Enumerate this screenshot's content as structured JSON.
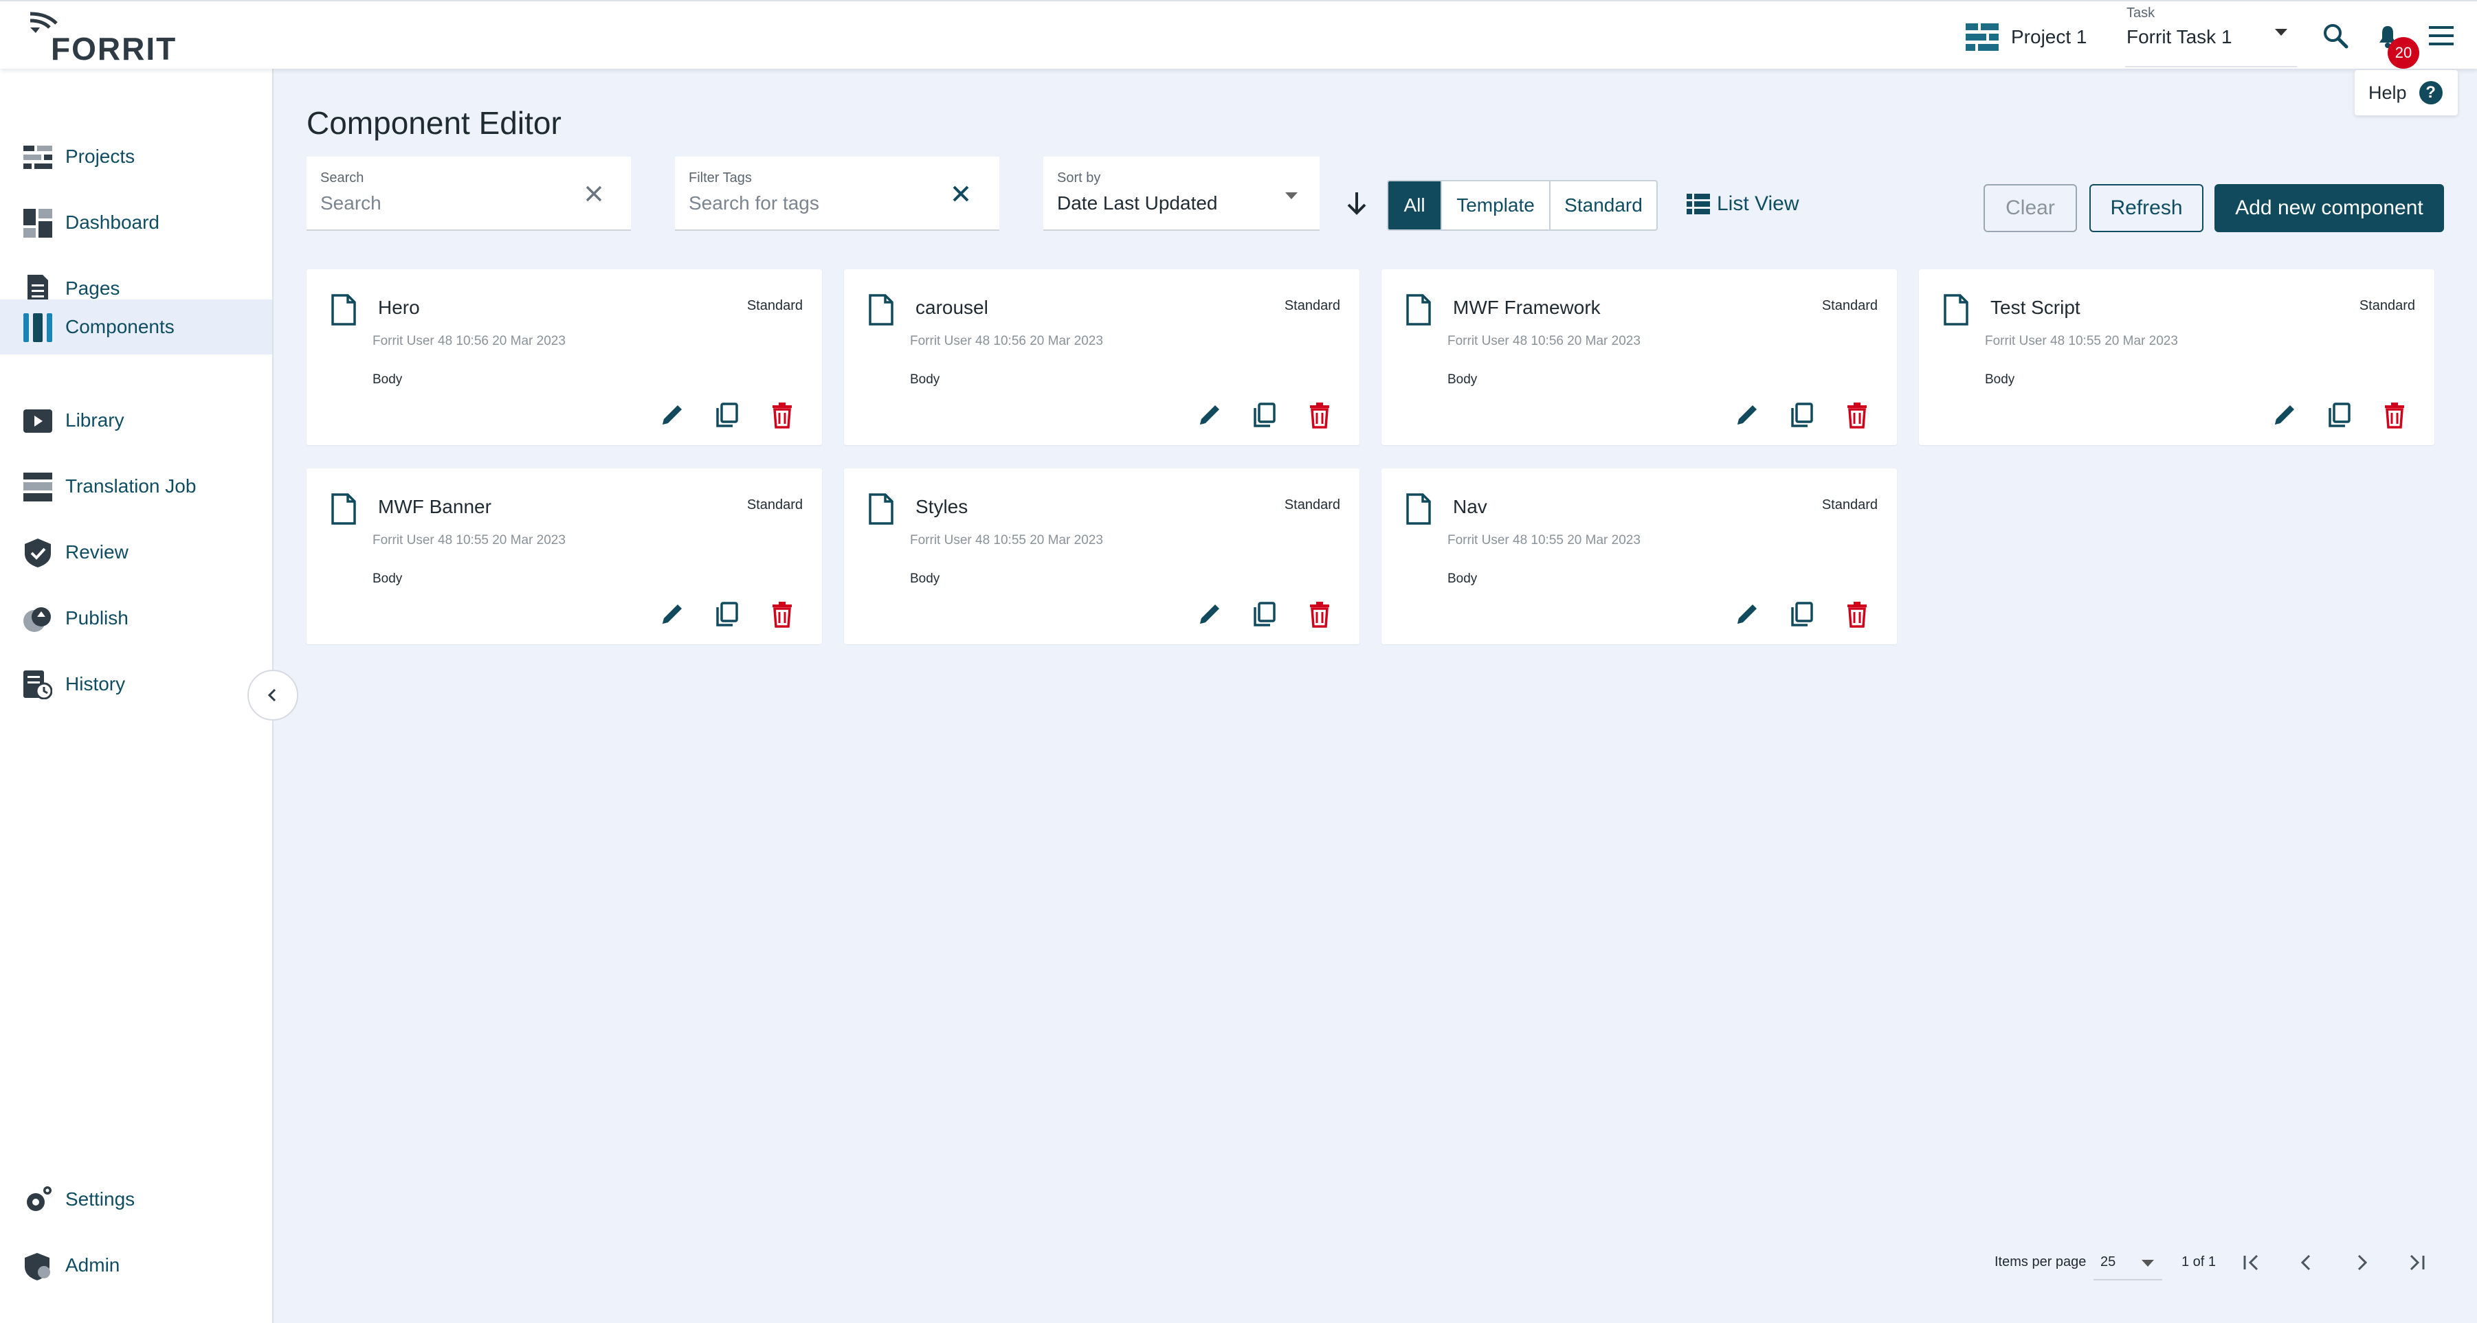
{
  "brand": {
    "name": "FORRIT"
  },
  "header": {
    "project_label": "Project 1",
    "task_label": "Task",
    "task_value": "Forrit Task 1",
    "notifications_count": "20",
    "help_label": "Help"
  },
  "sidebar": {
    "items": [
      {
        "label": "Projects",
        "icon": "projects-icon"
      },
      {
        "label": "Dashboard",
        "icon": "dashboard-icon"
      },
      {
        "label": "Pages",
        "icon": "pages-icon"
      },
      {
        "label": "Components",
        "icon": "components-icon",
        "active": true
      },
      {
        "label": "Library",
        "icon": "library-icon"
      },
      {
        "label": "Translation Job",
        "icon": "translation-icon"
      },
      {
        "label": "Review",
        "icon": "review-icon"
      },
      {
        "label": "Publish",
        "icon": "publish-icon"
      },
      {
        "label": "History",
        "icon": "history-icon"
      }
    ],
    "bottom_items": [
      {
        "label": "Settings",
        "icon": "settings-icon"
      },
      {
        "label": "Admin",
        "icon": "admin-icon"
      }
    ]
  },
  "main": {
    "title": "Component Editor",
    "search": {
      "label": "Search",
      "placeholder": "Search"
    },
    "filter_tags": {
      "label": "Filter Tags",
      "placeholder": "Search for tags"
    },
    "sort": {
      "label": "Sort by",
      "value": "Date Last Updated"
    },
    "filters": [
      "All",
      "Template",
      "Standard"
    ],
    "active_filter": "All",
    "list_view_label": "List View",
    "clear_label": "Clear",
    "refresh_label": "Refresh",
    "add_label": "Add new component"
  },
  "components": [
    {
      "name": "Hero",
      "type": "Standard",
      "meta": "Forrit User 48 10:56 20 Mar 2023",
      "tag": "Body"
    },
    {
      "name": "carousel",
      "type": "Standard",
      "meta": "Forrit User 48 10:56 20 Mar 2023",
      "tag": "Body"
    },
    {
      "name": "MWF Framework",
      "type": "Standard",
      "meta": "Forrit User 48 10:56 20 Mar 2023",
      "tag": "Body"
    },
    {
      "name": "Test Script",
      "type": "Standard",
      "meta": "Forrit User 48 10:55 20 Mar 2023",
      "tag": "Body"
    },
    {
      "name": "MWF Banner",
      "type": "Standard",
      "meta": "Forrit User 48 10:55 20 Mar 2023",
      "tag": "Body"
    },
    {
      "name": "Styles",
      "type": "Standard",
      "meta": "Forrit User 48 10:55 20 Mar 2023",
      "tag": "Body"
    },
    {
      "name": "Nav",
      "type": "Standard",
      "meta": "Forrit User 48 10:55 20 Mar 2023",
      "tag": "Body"
    }
  ],
  "pagination": {
    "items_per_page_label": "Items per page",
    "items_per_page": "25",
    "range": "1 of 1"
  },
  "colors": {
    "primary": "#104a5c",
    "background": "#eef2fa",
    "delete": "#d0021b",
    "badge": "#d0021b"
  }
}
